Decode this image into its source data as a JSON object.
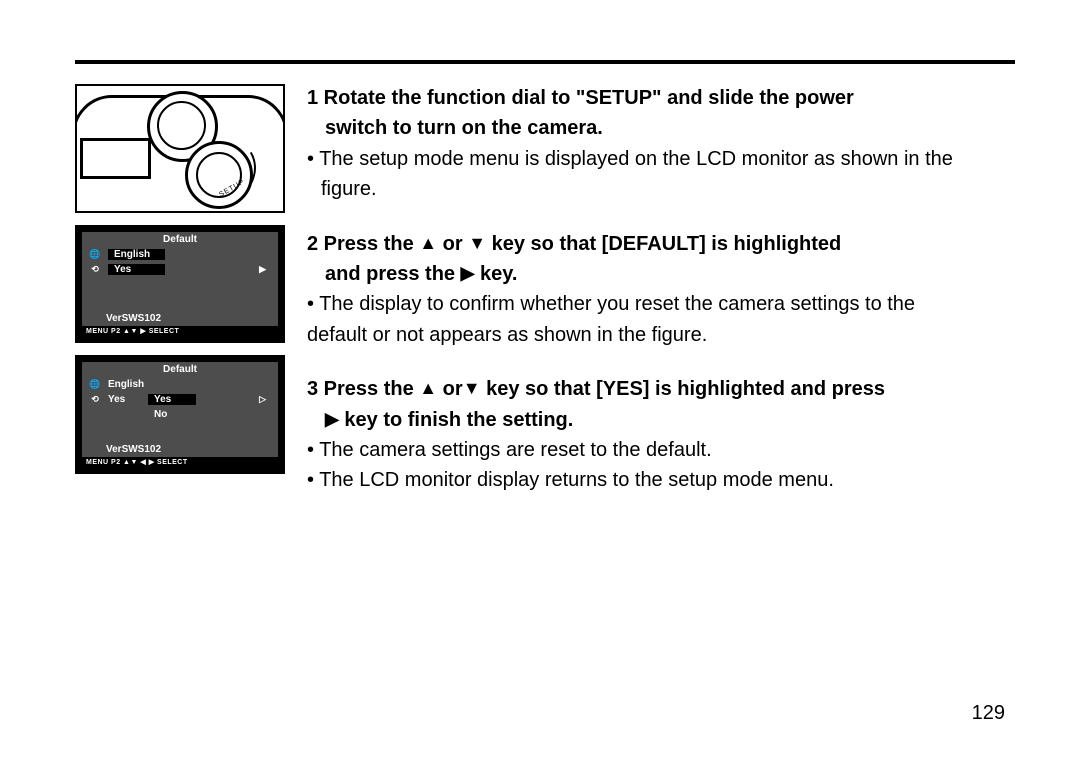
{
  "hr": true,
  "page_number": "129",
  "triangles": {
    "up": "▲",
    "down": "▼",
    "right": "▶",
    "right_hollow": "▷"
  },
  "camera_diagram": {
    "setup_label": "SETUP"
  },
  "lcd1": {
    "title": "Default",
    "row_english": "English",
    "row_yes": "Yes",
    "yes_tri": "▶",
    "version": "VerSWS102",
    "footer": "MENU P2   ▲▼ ▶ SELECT"
  },
  "lcd2": {
    "title": "Default",
    "row_english": "English",
    "row_yes": "Yes",
    "opt_yes": "Yes",
    "opt_no": "No",
    "opt_tri": "▷",
    "version": "VerSWS102",
    "footer": "MENU P2   ▲▼ ◀ ▶ SELECT"
  },
  "steps": {
    "s1": {
      "head_a": "1 Rotate the function dial to \"SETUP\" and slide the power",
      "head_b": "switch to turn on the camera.",
      "b1_a": "• The setup mode menu is displayed on the LCD monitor as shown in the",
      "b1_b": "figure."
    },
    "s2": {
      "head_a_pre": "2 Press the ",
      "head_a_mid": " or ",
      "head_a_post": "  key so that [DEFAULT] is highlighted",
      "head_b_pre": "and press the  ",
      "head_b_post": "  key.",
      "b1_a": "• The display to confirm whether you reset the camera settings to the",
      "b1_b": "default or not appears as shown in the figure."
    },
    "s3": {
      "head_a_pre": "3 Press the ",
      "head_a_mid": "  or",
      "head_a_post": "  key so that [YES] is highlighted and press",
      "head_b_post": "  key to finish the setting.",
      "b1": "• The camera settings are reset to the default.",
      "b2": "• The LCD monitor display returns to the setup mode menu."
    }
  }
}
